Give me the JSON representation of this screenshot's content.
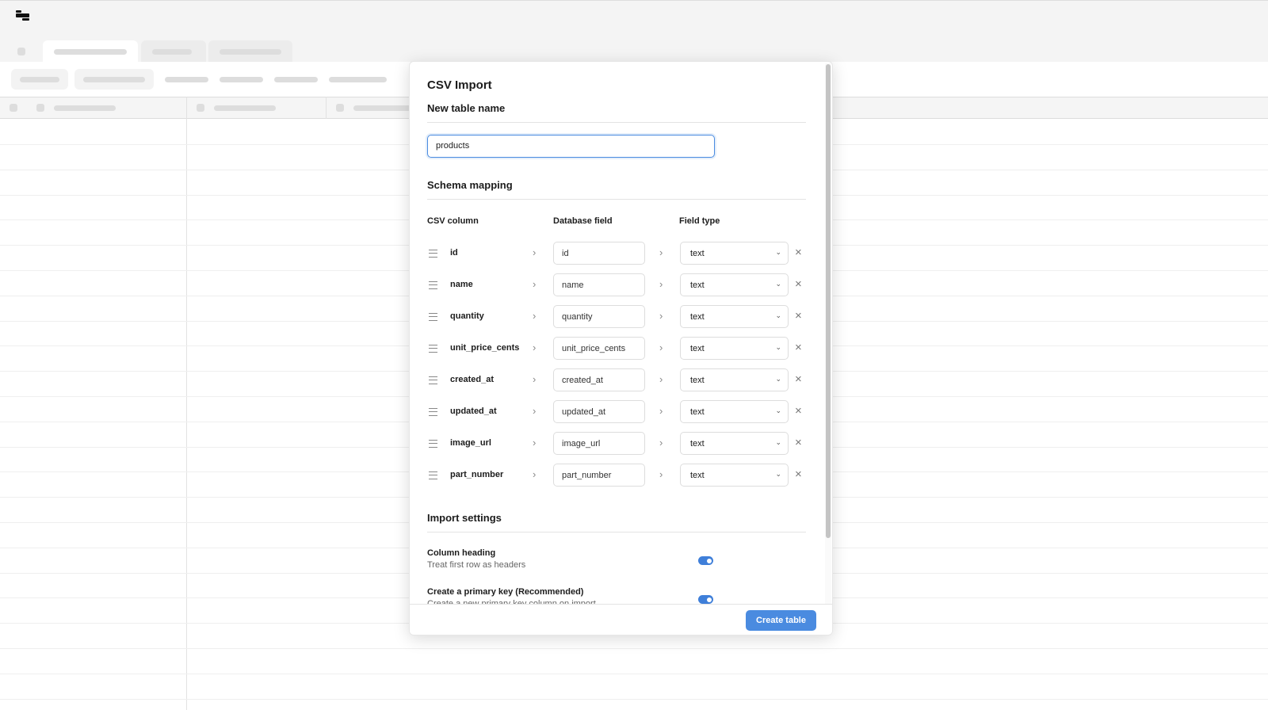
{
  "modal": {
    "title": "CSV Import",
    "table_name_label": "New table name",
    "table_name_value": "products",
    "schema_label": "Schema mapping",
    "columns": {
      "csv": "CSV column",
      "db": "Database field",
      "type": "Field type"
    },
    "rows": [
      {
        "csv": "id",
        "db": "id",
        "type": "text"
      },
      {
        "csv": "name",
        "db": "name",
        "type": "text"
      },
      {
        "csv": "quantity",
        "db": "quantity",
        "type": "text"
      },
      {
        "csv": "unit_price_cents",
        "db": "unit_price_cents",
        "type": "text"
      },
      {
        "csv": "created_at",
        "db": "created_at",
        "type": "text"
      },
      {
        "csv": "updated_at",
        "db": "updated_at",
        "type": "text"
      },
      {
        "csv": "image_url",
        "db": "image_url",
        "type": "text"
      },
      {
        "csv": "part_number",
        "db": "part_number",
        "type": "text"
      }
    ],
    "settings_label": "Import settings",
    "settings": [
      {
        "label": "Column heading",
        "sub": "Treat first row as headers",
        "on": true
      },
      {
        "label": "Create a primary key (Recommended)",
        "sub": "Create a new primary key column on import",
        "on": true
      }
    ],
    "create_button": "Create table",
    "accent": "#4a8be0"
  }
}
